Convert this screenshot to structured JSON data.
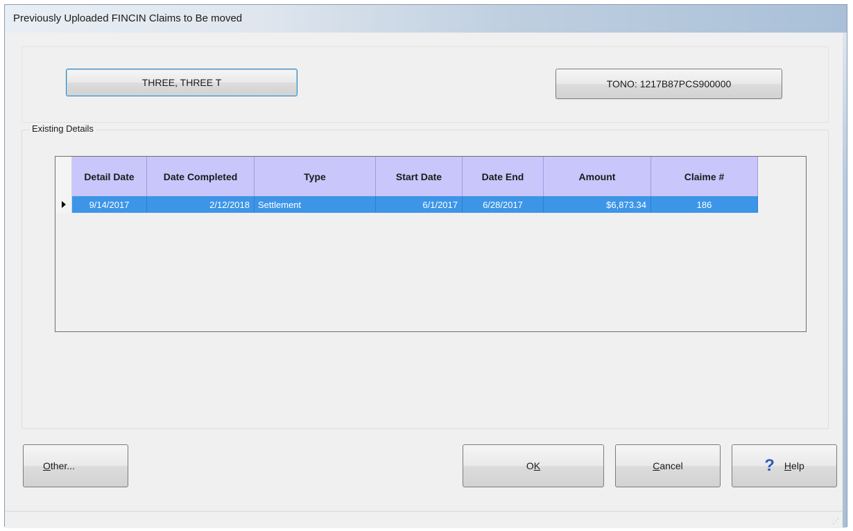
{
  "window": {
    "title": "Previously Uploaded FINCIN Claims to Be moved"
  },
  "top": {
    "name_button": "THREE, THREE T",
    "tono_button": "TONO: 1217B87PCS900000"
  },
  "details": {
    "group_label": "Existing Details",
    "columns": [
      "Detail Date",
      "Date Completed",
      "Type",
      "Start Date",
      "Date End",
      "Amount",
      "Claime #"
    ],
    "rows": [
      {
        "detail_date": "9/14/2017",
        "date_completed": "2/12/2018",
        "type": "Settlement",
        "start_date": "6/1/2017",
        "date_end": "6/28/2017",
        "amount": "$6,873.34",
        "claim_no": "186",
        "selected": true
      }
    ]
  },
  "buttons": {
    "other": {
      "mnemonic": "O",
      "rest": "ther..."
    },
    "ok": {
      "first": "O",
      "mnemonic": "K"
    },
    "cancel": {
      "mnemonic": "C",
      "rest": "ancel"
    },
    "help": {
      "mnemonic": "H",
      "rest": "elp",
      "icon": "question-mark-icon"
    }
  },
  "colors": {
    "header_bg": "#c8c6fb",
    "selected_row_bg": "#3d95e8"
  }
}
